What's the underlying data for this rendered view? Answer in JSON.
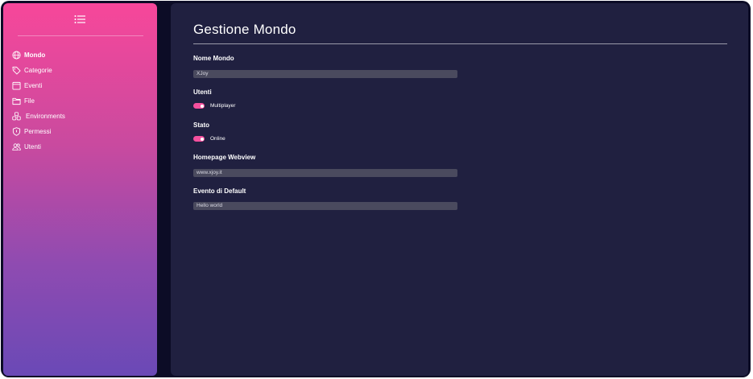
{
  "sidebar": {
    "menu_icon": "list-icon",
    "items": [
      {
        "label": "Mondo",
        "icon": "globe-icon",
        "active": true
      },
      {
        "label": "Categorie",
        "icon": "tag-icon",
        "active": false
      },
      {
        "label": "Eventi",
        "icon": "calendar-icon",
        "active": false
      },
      {
        "label": "File",
        "icon": "folder-icon",
        "active": false
      },
      {
        "label": "Environments",
        "icon": "cubes-icon",
        "active": false
      },
      {
        "label": "Permessi",
        "icon": "shield-icon",
        "active": false
      },
      {
        "label": "Utenti",
        "icon": "users-icon",
        "active": false
      }
    ],
    "colors": {
      "gradient_top": "#f7479a",
      "gradient_bottom": "#6a49b6"
    }
  },
  "main": {
    "title": "Gestione Mondo",
    "background": "#202040",
    "fields": {
      "nome_mondo": {
        "label": "Nome Mondo",
        "value": "XJoy"
      },
      "utenti": {
        "label": "Utenti",
        "toggle_label": "Multiplayer",
        "enabled": true
      },
      "stato": {
        "label": "Stato",
        "toggle_label": "Online",
        "enabled": true
      },
      "homepage": {
        "label": "Homepage Webview",
        "value": "www.xjoy.it"
      },
      "evento_default": {
        "label": "Evento di Default",
        "value": "Hello world"
      }
    },
    "accent_color": "#f5509e"
  }
}
